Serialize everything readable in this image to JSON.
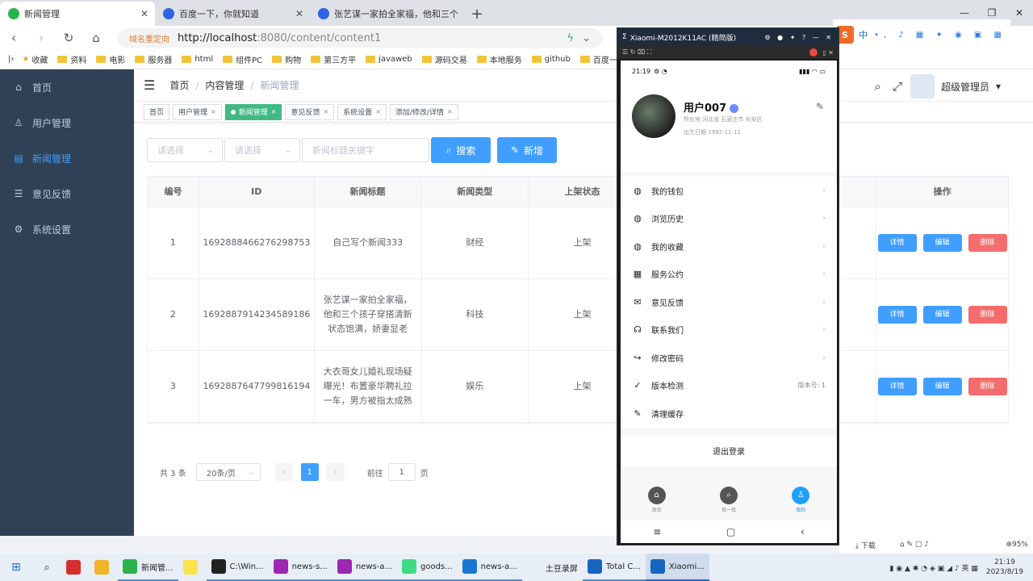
{
  "browser": {
    "tabs": [
      {
        "title": "新闻管理",
        "active": true,
        "color": "#2bb24c"
      },
      {
        "title": "百度一下，你就知道",
        "active": false,
        "color": "#2e64e3"
      },
      {
        "title": "张艺谋一家拍全家福，他和三个",
        "active": false,
        "color": "#2e64e3"
      }
    ],
    "url_redirect": "域名重定向",
    "url_host": "http://localhost",
    "url_path": ":8080/content/content1",
    "bookmarks": [
      "收藏",
      "资料",
      "电影",
      "服务器",
      "html",
      "组件PC",
      "购物",
      "第三方平",
      "javaweb",
      "源码交易",
      "本地服务",
      "github",
      "百度一"
    ]
  },
  "sidebar": {
    "items": [
      {
        "label": "首页",
        "icon": "home-icon",
        "glyph": "⌂",
        "active": false
      },
      {
        "label": "用户管理",
        "icon": "user-icon",
        "glyph": "♙",
        "active": false
      },
      {
        "label": "新闻管理",
        "icon": "document-icon",
        "glyph": "▤",
        "active": true
      },
      {
        "label": "意见反馈",
        "icon": "message-icon",
        "glyph": "☰",
        "active": false
      },
      {
        "label": "系统设置",
        "icon": "gear-icon",
        "glyph": "⚙",
        "active": false
      }
    ]
  },
  "header": {
    "breadcrumb": [
      "首页",
      "内容管理",
      "新闻管理"
    ],
    "admin_name": "超级管理员"
  },
  "tags": [
    {
      "label": "首页",
      "active": false,
      "closable": false
    },
    {
      "label": "用户管理",
      "active": false,
      "closable": true
    },
    {
      "label": "新闻管理",
      "active": true,
      "closable": true
    },
    {
      "label": "意见反馈",
      "active": false,
      "closable": true
    },
    {
      "label": "系统设置",
      "active": false,
      "closable": true
    },
    {
      "label": "添加/修改/详情",
      "active": false,
      "closable": true
    }
  ],
  "filters": {
    "select1_placeholder": "请选择",
    "select2_placeholder": "请选择",
    "keyword_placeholder": "新闻标题关键字",
    "search_label": "搜索",
    "add_label": "新增"
  },
  "table": {
    "columns": [
      "编号",
      "ID",
      "新闻标题",
      "新闻类型",
      "上架状态",
      "",
      "操作"
    ],
    "rows": [
      {
        "no": "1",
        "id": "1692888466276298753",
        "title": "自己写个新闻333",
        "type": "财经",
        "status": "上架"
      },
      {
        "no": "2",
        "id": "1692887914234589186",
        "title": "张艺谋一家拍全家福，他和三个孩子穿搭清新状态饱满，娇妻显老",
        "type": "科技",
        "status": "上架"
      },
      {
        "no": "3",
        "id": "1692887647799816194",
        "title": "大衣哥女儿婚礼现场疑曝光！布置豪华聘礼拉一车，男方被指太成熟",
        "type": "娱乐",
        "status": "上架"
      }
    ],
    "op_labels": {
      "detail": "详情",
      "edit": "编辑",
      "delete": "删除"
    }
  },
  "pagination": {
    "total": "共 3 条",
    "page_size": "20条/页",
    "current_page": "1",
    "goto_prefix": "前往",
    "goto_value": "1",
    "goto_suffix": "页"
  },
  "phone": {
    "window_title": "Xiaomi-M2012K11AC (精简版)",
    "time": "21:19",
    "username": "用户007",
    "location": "所在地 河北省 石家庄市 长安区",
    "birthday": "出生日期 1992-11-11",
    "menu": [
      {
        "label": "我的钱包",
        "icon": "wallet-icon",
        "glyph": "◍",
        "arrow": true
      },
      {
        "label": "浏览历史",
        "icon": "history-icon",
        "glyph": "◍",
        "arrow": true
      },
      {
        "label": "我的收藏",
        "icon": "favorite-icon",
        "glyph": "◍",
        "arrow": true
      },
      {
        "label": "服务公约",
        "icon": "agreement-icon",
        "glyph": "▦",
        "arrow": true
      },
      {
        "label": "意见反馈",
        "icon": "mail-icon",
        "glyph": "✉",
        "arrow": true
      },
      {
        "label": "联系我们",
        "icon": "headset-icon",
        "glyph": "☊",
        "arrow": true
      },
      {
        "label": "修改密码",
        "icon": "logout-arrow-icon",
        "glyph": "↪",
        "arrow": true
      },
      {
        "label": "版本检测",
        "icon": "check-icon",
        "glyph": "✓",
        "version": "版本号: 1"
      },
      {
        "label": "清理缓存",
        "icon": "broom-icon",
        "glyph": "✎",
        "arrow": false
      }
    ],
    "logout": "退出登录",
    "bottom_tabs": [
      {
        "label": "首页",
        "active": false
      },
      {
        "label": "找一找",
        "active": false
      },
      {
        "label": "我的",
        "active": true
      }
    ]
  },
  "ime": {
    "logo": "S",
    "lang": "中"
  },
  "browser_status": {
    "download": "下载",
    "zoom": "95%"
  },
  "taskbar": {
    "apps": [
      {
        "label": "",
        "color": "#d32f2f"
      },
      {
        "label": "",
        "color": "#f0b429"
      },
      {
        "label": "新闻管...",
        "color": "#2bb24c",
        "state": "running"
      },
      {
        "label": "",
        "color": "#fce34a"
      },
      {
        "label": "C:\\Win...",
        "color": "#222",
        "state": "running"
      },
      {
        "label": "news-s...",
        "color": "#9c27b0",
        "state": "running"
      },
      {
        "label": "news-a...",
        "color": "#9c27b0",
        "state": "running"
      },
      {
        "label": "goods...",
        "color": "#3ddc84",
        "state": "running"
      },
      {
        "label": "news-a...",
        "color": "#1976d2",
        "state": "running"
      },
      {
        "label": "土豆录屏",
        "color": "#e8eef5",
        "state": "plain"
      },
      {
        "label": "Total C...",
        "color": "#1565c0",
        "state": "running"
      },
      {
        "label": "Xiaomi...",
        "color": "#1565c0",
        "state": "active"
      }
    ],
    "time": "21:19",
    "date": "2023/8/19"
  }
}
